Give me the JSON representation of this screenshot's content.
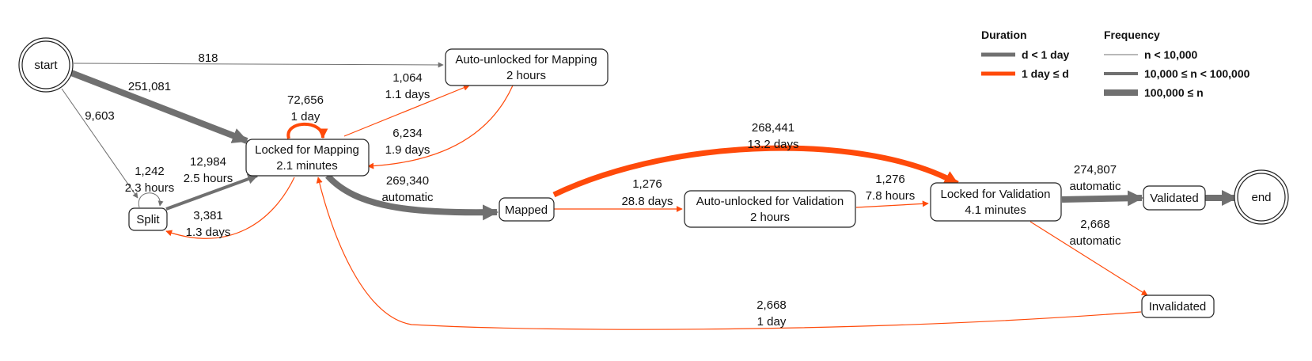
{
  "legend": {
    "duration_title": "Duration",
    "duration_items": [
      {
        "label": "d < 1 day",
        "color": "#707070"
      },
      {
        "label": "1 day ≤ d",
        "color": "#ff4a0a"
      }
    ],
    "frequency_title": "Frequency",
    "frequency_items": [
      {
        "label": "n < 10,000"
      },
      {
        "label": "10,000 ≤ n < 100,000"
      },
      {
        "label": "100,000 ≤ n"
      }
    ]
  },
  "colors": {
    "short": "#707070",
    "long": "#ff4a0a",
    "node_stroke": "#222222"
  },
  "nodes": {
    "start": {
      "label": "start"
    },
    "end": {
      "label": "end"
    },
    "auto_mapping": {
      "line1": "Auto-unlocked for Mapping",
      "line2": "2 hours"
    },
    "locked_mapping": {
      "line1": "Locked for Mapping",
      "line2": "2.1 minutes"
    },
    "split": {
      "label": "Split"
    },
    "mapped": {
      "label": "Mapped"
    },
    "auto_validation": {
      "line1": "Auto-unlocked for Validation",
      "line2": "2 hours"
    },
    "locked_validation": {
      "line1": "Locked for Validation",
      "line2": "4.1 minutes"
    },
    "validated": {
      "label": "Validated"
    },
    "invalidated": {
      "label": "Invalidated"
    }
  },
  "edges": [
    {
      "id": "start_to_auto_mapping",
      "from": "start",
      "to": "Auto-unlocked for Mapping",
      "count": "818",
      "duration": "",
      "duration_class": "d < 1 day",
      "frequency_class": "n < 10,000"
    },
    {
      "id": "start_to_locked_mapping",
      "from": "start",
      "to": "Locked for Mapping",
      "count": "251,081",
      "duration": "",
      "duration_class": "d < 1 day",
      "frequency_class": "100,000 ≤ n"
    },
    {
      "id": "start_to_split",
      "from": "start",
      "to": "Split",
      "count": "9,603",
      "duration": "",
      "duration_class": "d < 1 day",
      "frequency_class": "n < 10,000"
    },
    {
      "id": "locked_mapping_self",
      "from": "Locked for Mapping",
      "to": "Locked for Mapping",
      "count": "72,656",
      "duration": "1 day",
      "duration_class": "1 day ≤ d",
      "frequency_class": "10,000 ≤ n < 100,000"
    },
    {
      "id": "locked_mapping_to_auto_mapping",
      "from": "Locked for Mapping",
      "to": "Auto-unlocked for Mapping",
      "count": "1,064",
      "duration": "1.1 days",
      "duration_class": "1 day ≤ d",
      "frequency_class": "n < 10,000"
    },
    {
      "id": "auto_mapping_to_locked_mapping",
      "from": "Auto-unlocked for Mapping",
      "to": "Locked for Mapping",
      "count": "6,234",
      "duration": "1.9 days",
      "duration_class": "1 day ≤ d",
      "frequency_class": "n < 10,000"
    },
    {
      "id": "split_self",
      "from": "Split",
      "to": "Split",
      "count": "1,242",
      "duration": "2.3 hours",
      "duration_class": "d < 1 day",
      "frequency_class": "n < 10,000"
    },
    {
      "id": "split_to_locked_mapping",
      "from": "Split",
      "to": "Locked for Mapping",
      "count": "12,984",
      "duration": "2.5 hours",
      "duration_class": "d < 1 day",
      "frequency_class": "10,000 ≤ n < 100,000"
    },
    {
      "id": "locked_mapping_to_split",
      "from": "Locked for Mapping",
      "to": "Split",
      "count": "3,381",
      "duration": "1.3 days",
      "duration_class": "1 day ≤ d",
      "frequency_class": "n < 10,000"
    },
    {
      "id": "locked_mapping_to_mapped",
      "from": "Locked for Mapping",
      "to": "Mapped",
      "count": "269,340",
      "duration": "automatic",
      "duration_class": "d < 1 day",
      "frequency_class": "100,000 ≤ n"
    },
    {
      "id": "mapped_to_locked_validation",
      "from": "Mapped",
      "to": "Locked for Validation",
      "count": "268,441",
      "duration": "13.2 days",
      "duration_class": "1 day ≤ d",
      "frequency_class": "100,000 ≤ n"
    },
    {
      "id": "mapped_to_auto_validation",
      "from": "Mapped",
      "to": "Auto-unlocked for Validation",
      "count": "1,276",
      "duration": "28.8 days",
      "duration_class": "1 day ≤ d",
      "frequency_class": "n < 10,000"
    },
    {
      "id": "auto_validation_to_locked_validation",
      "from": "Auto-unlocked for Validation",
      "to": "Locked for Validation",
      "count": "1,276",
      "duration": "7.8 hours",
      "duration_class": "1 day ≤ d",
      "frequency_class": "n < 10,000"
    },
    {
      "id": "locked_validation_to_validated",
      "from": "Locked for Validation",
      "to": "Validated",
      "count": "274,807",
      "duration": "automatic",
      "duration_class": "d < 1 day",
      "frequency_class": "100,000 ≤ n"
    },
    {
      "id": "validated_to_end",
      "from": "Validated",
      "to": "end",
      "count": "",
      "duration": "",
      "duration_class": "d < 1 day",
      "frequency_class": "100,000 ≤ n"
    },
    {
      "id": "locked_validation_to_invalidated",
      "from": "Locked for Validation",
      "to": "Invalidated",
      "count": "2,668",
      "duration": "automatic",
      "duration_class": "1 day ≤ d",
      "frequency_class": "n < 10,000"
    },
    {
      "id": "invalidated_to_locked_mapping",
      "from": "Invalidated",
      "to": "Locked for Mapping",
      "count": "2,668",
      "duration": "1 day",
      "duration_class": "1 day ≤ d",
      "frequency_class": "n < 10,000"
    }
  ]
}
